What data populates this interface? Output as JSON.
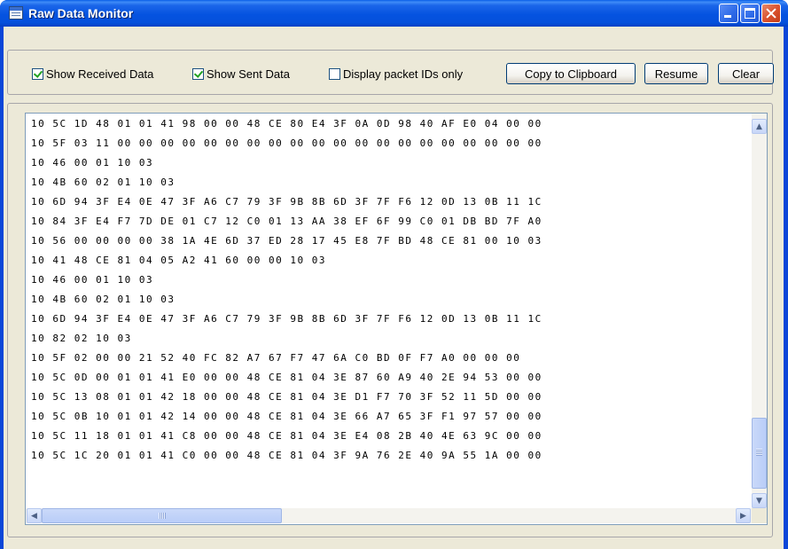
{
  "window": {
    "title": "Raw Data Monitor",
    "title_bar_color": "#0553e0",
    "client_color": "#ece9d8"
  },
  "title_buttons": {
    "minimize_icon": "minimize-icon",
    "maximize_icon": "maximize-icon",
    "close_icon": "close-icon"
  },
  "options": {
    "show_received": {
      "label": "Show Received Data",
      "checked": true
    },
    "show_sent": {
      "label": "Show Sent Data",
      "checked": true
    },
    "packet_ids_only": {
      "label": "Display packet IDs only",
      "checked": false
    }
  },
  "buttons": {
    "copy": "Copy to Clipboard",
    "resume": "Resume",
    "clear": "Clear"
  },
  "data_lines": [
    "10 5C 1D 48 01 01 41 98 00 00 48 CE 80 E4 3F 0A 0D 98 40 AF E0 04 00 00",
    "10 5F 03 11 00 00 00 00 00 00 00 00 00 00 00 00 00 00 00 00 00 00 00 00",
    "10 46 00 01 10 03",
    "10 4B 60 02 01 10 03",
    "10 6D 94 3F E4 0E 47 3F A6 C7 79 3F 9B 8B 6D 3F 7F F6 12 0D 13 0B 11 1C",
    "10 84 3F E4 F7 7D DE 01 C7 12 C0 01 13 AA 38 EF 6F 99 C0 01 DB BD 7F A0",
    "10 56 00 00 00 00 38 1A 4E 6D 37 ED 28 17 45 E8 7F BD 48 CE 81 00 10 03",
    "10 41 48 CE 81 04 05 A2 41 60 00 00 10 03",
    "10 46 00 01 10 03",
    "10 4B 60 02 01 10 03",
    "10 6D 94 3F E4 0E 47 3F A6 C7 79 3F 9B 8B 6D 3F 7F F6 12 0D 13 0B 11 1C",
    "10 82 02 10 03",
    "10 5F 02 00 00 21 52 40 FC 82 A7 67 F7 47 6A C0 BD 0F F7 A0 00 00 00",
    "10 5C 0D 00 01 01 41 E0 00 00 48 CE 81 04 3E 87 60 A9 40 2E 94 53 00 00",
    "10 5C 13 08 01 01 42 18 00 00 48 CE 81 04 3E D1 F7 70 3F 52 11 5D 00 00",
    "10 5C 0B 10 01 01 42 14 00 00 48 CE 81 04 3E 66 A7 65 3F F1 97 57 00 00",
    "10 5C 11 18 01 01 41 C8 00 00 48 CE 81 04 3E E4 08 2B 40 4E 63 9C 00 00",
    "10 5C 1C 20 01 01 41 C0 00 00 48 CE 81 04 3F 9A 76 2E 40 9A 55 1A 00 00"
  ],
  "scrollbars": {
    "up_icon": "scroll-up-icon",
    "down_icon": "scroll-down-icon",
    "left_icon": "scroll-left-icon",
    "right_icon": "scroll-right-icon"
  }
}
